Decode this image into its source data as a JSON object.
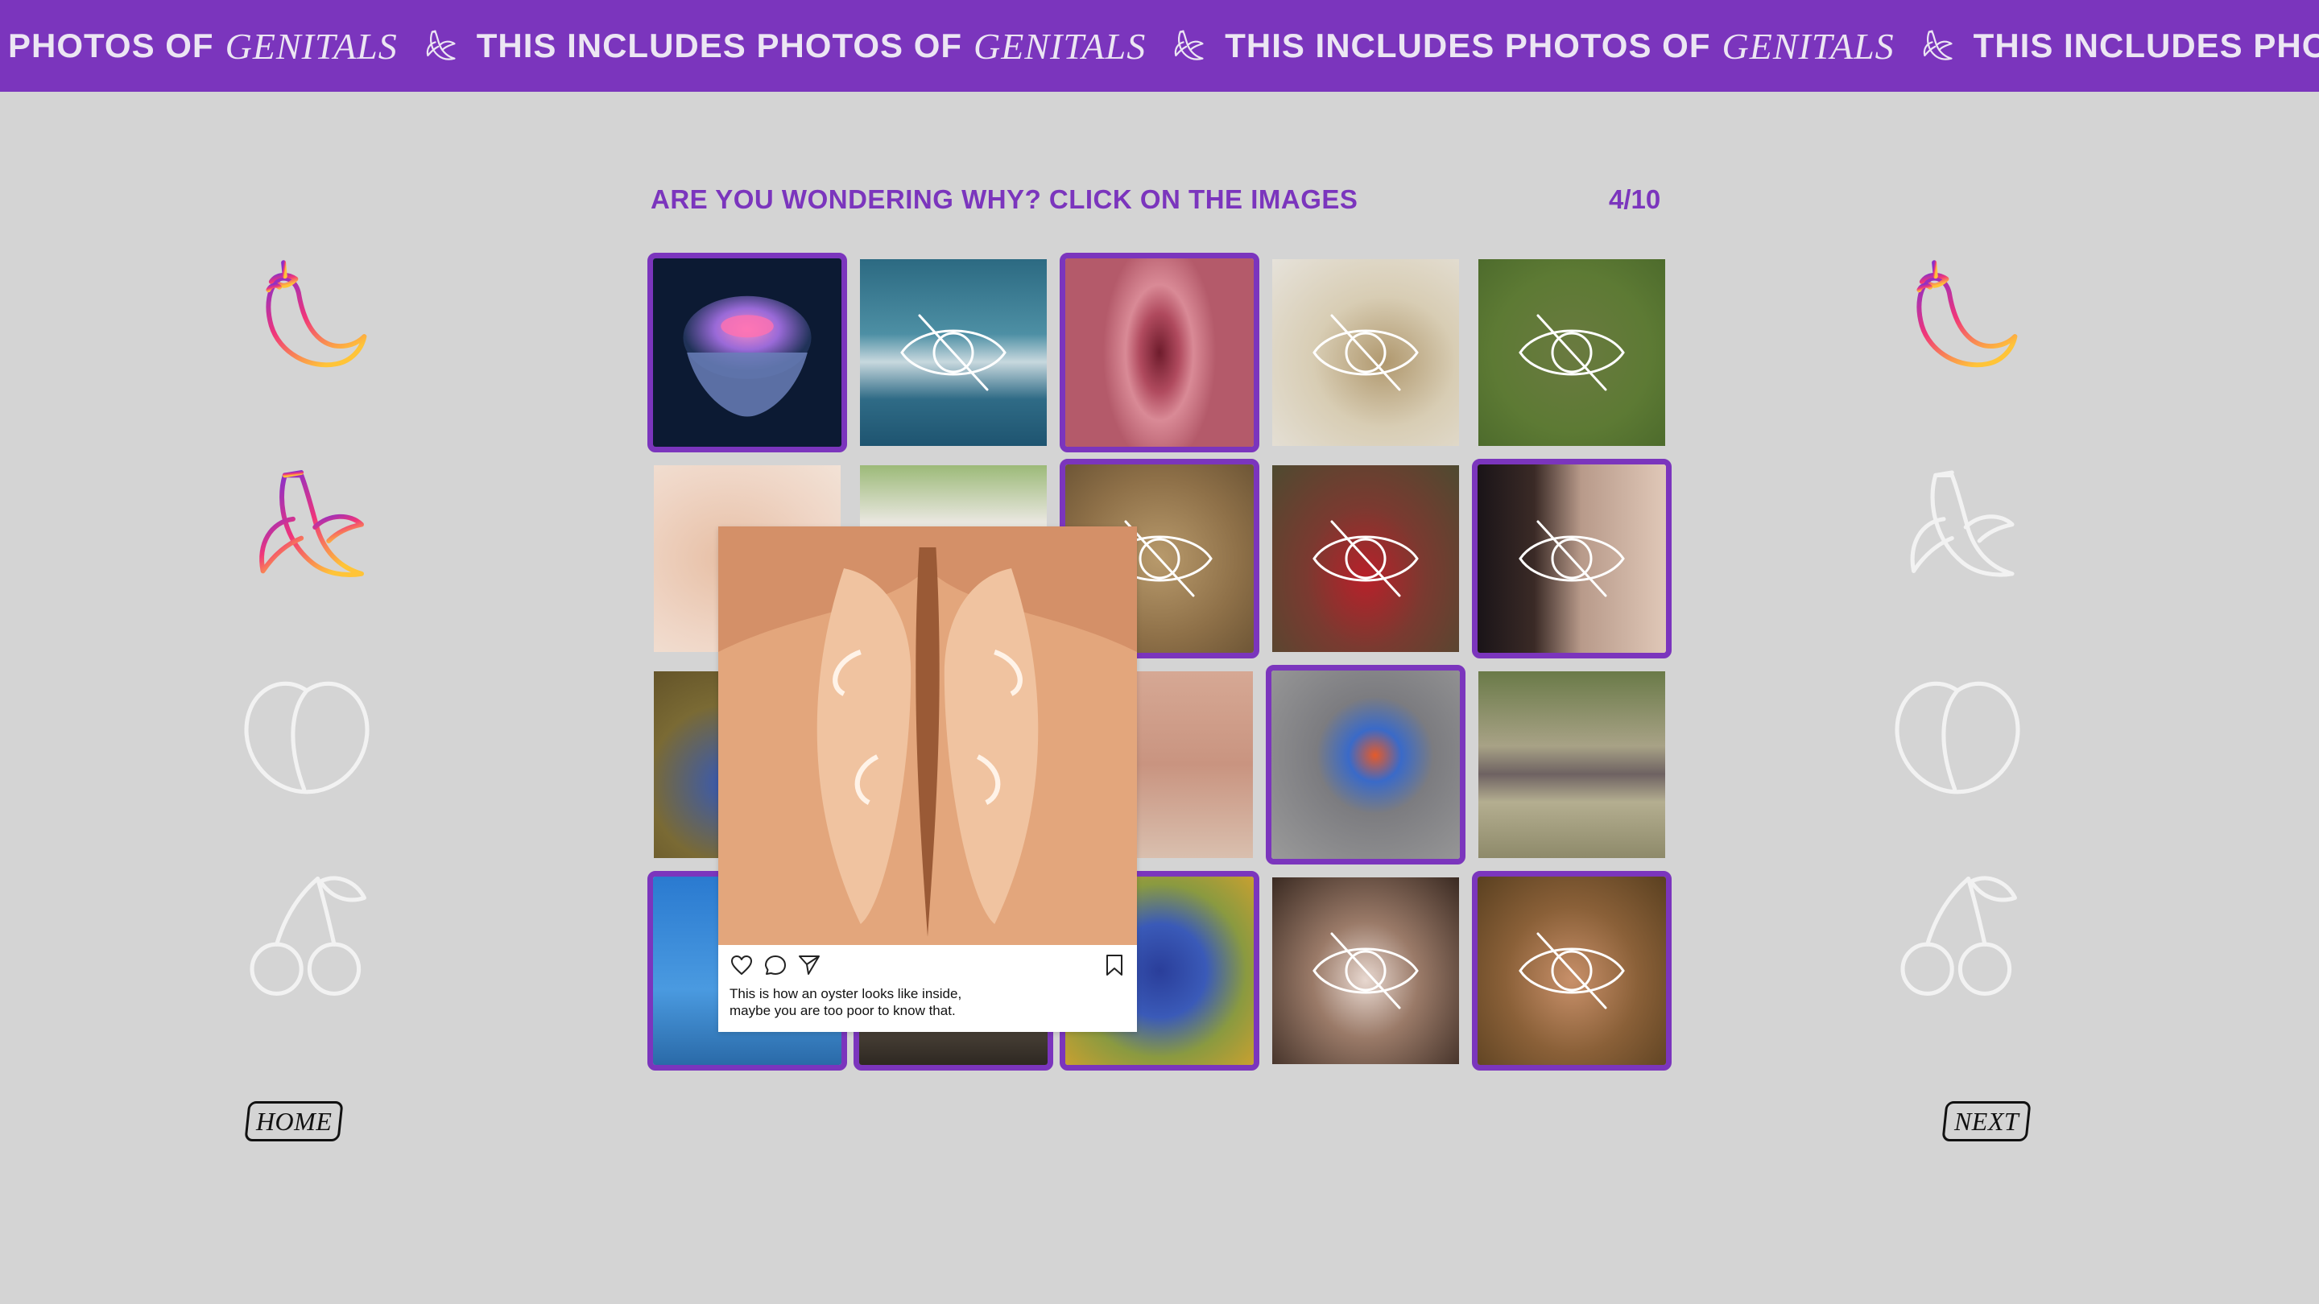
{
  "banner": {
    "segments": [
      {
        "sans": "PHOTOS OF",
        "serif": "GENITALS"
      },
      {
        "sans": "THIS INCLUDES PHOTOS OF",
        "serif": "GENITALS"
      },
      {
        "sans": "THIS INCLUDES PHOTOS OF",
        "serif": "GENITALS"
      },
      {
        "sans": "THIS INCLUDES PHOTOS",
        "serif": ""
      }
    ],
    "icon": "banana-icon"
  },
  "header": {
    "prompt": "ARE YOU WONDERING WHY? CLICK ON THE IMAGES",
    "counter": "4/10"
  },
  "side_icons": {
    "left": [
      {
        "icon": "eggplant-icon",
        "active": true
      },
      {
        "icon": "banana-icon",
        "active": true
      },
      {
        "icon": "peach-icon",
        "active": false
      },
      {
        "icon": "cherry-icon",
        "active": false
      }
    ],
    "right": [
      {
        "icon": "eggplant-icon",
        "active": true
      },
      {
        "icon": "banana-icon",
        "active": false
      },
      {
        "icon": "peach-icon",
        "active": false
      },
      {
        "icon": "cherry-icon",
        "active": false
      }
    ]
  },
  "tiles": [
    {
      "subject": "jellyfish",
      "selected": true,
      "hidden": false
    },
    {
      "subject": "ocean wave",
      "selected": false,
      "hidden": true
    },
    {
      "subject": "pink folds",
      "selected": true,
      "hidden": false
    },
    {
      "subject": "barnacle",
      "selected": false,
      "hidden": true
    },
    {
      "subject": "green leaf",
      "selected": false,
      "hidden": true
    },
    {
      "subject": "skin close-up",
      "selected": false,
      "hidden": true
    },
    {
      "subject": "white animal",
      "selected": false,
      "hidden": true
    },
    {
      "subject": "brown texture",
      "selected": true,
      "hidden": true
    },
    {
      "subject": "red sea creature",
      "selected": false,
      "hidden": true
    },
    {
      "subject": "dark blurred",
      "selected": true,
      "hidden": true
    },
    {
      "subject": "blue sea slug",
      "selected": false,
      "hidden": false
    },
    {
      "subject": "hidden",
      "selected": false,
      "hidden": false
    },
    {
      "subject": "hand",
      "selected": false,
      "hidden": false
    },
    {
      "subject": "peacock spider",
      "selected": true,
      "hidden": false
    },
    {
      "subject": "caecilian",
      "selected": false,
      "hidden": false
    },
    {
      "subject": "blue water",
      "selected": true,
      "hidden": true
    },
    {
      "subject": "shell",
      "selected": true,
      "hidden": false
    },
    {
      "subject": "giant clam",
      "selected": true,
      "hidden": false
    },
    {
      "subject": "blurred body",
      "selected": false,
      "hidden": true
    },
    {
      "subject": "blurred figure",
      "selected": true,
      "hidden": true
    }
  ],
  "post": {
    "caption_line1": "This is how an oyster looks like inside,",
    "caption_line2": "maybe you are too poor to know that.",
    "icons": [
      "heart-icon",
      "comment-icon",
      "share-icon",
      "bookmark-icon"
    ]
  },
  "nav": {
    "home": "HOME",
    "next": "NEXT"
  },
  "colors": {
    "accent": "#7b35bd",
    "background": "#d4d4d4",
    "banner_text": "#ece6f3"
  }
}
